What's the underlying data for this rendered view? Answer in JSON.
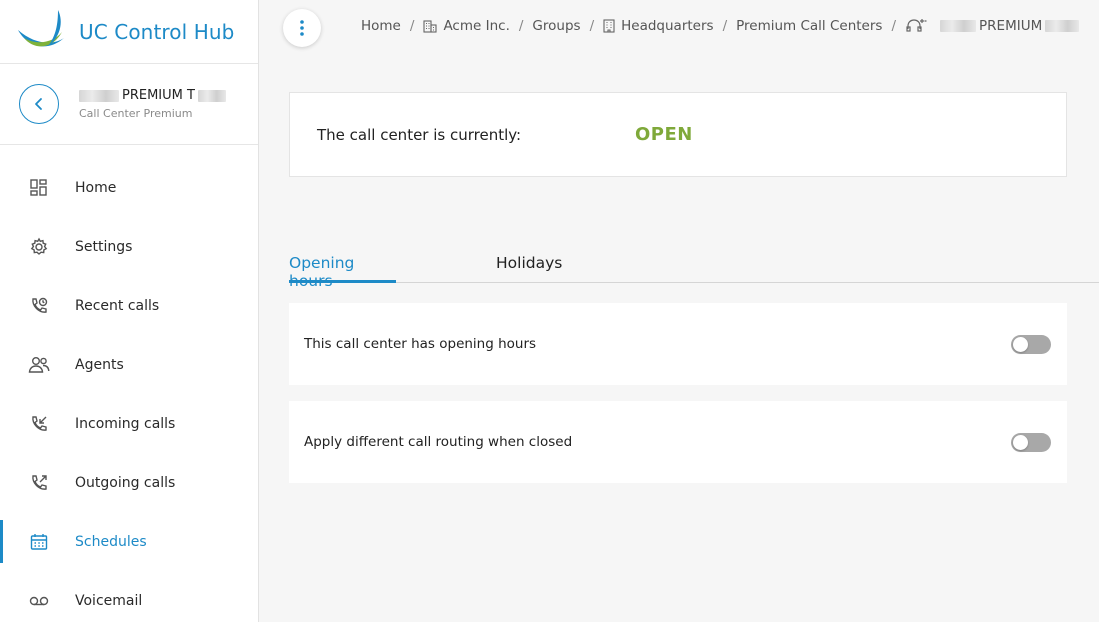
{
  "app": {
    "title": "UC Control Hub"
  },
  "entity": {
    "name_visible": "PREMIUM T",
    "subtitle": "Call Center Premium"
  },
  "sidebar": {
    "items": [
      {
        "label": "Home",
        "icon": "dashboard-icon"
      },
      {
        "label": "Settings",
        "icon": "gear-icon"
      },
      {
        "label": "Recent calls",
        "icon": "recent-calls-icon"
      },
      {
        "label": "Agents",
        "icon": "agents-icon"
      },
      {
        "label": "Incoming calls",
        "icon": "incoming-call-icon"
      },
      {
        "label": "Outgoing calls",
        "icon": "outgoing-call-icon"
      },
      {
        "label": "Schedules",
        "icon": "calendar-icon",
        "active": true
      },
      {
        "label": "Voicemail",
        "icon": "voicemail-icon"
      }
    ]
  },
  "breadcrumb": {
    "items": [
      "Home",
      "Acme Inc.",
      "Groups",
      "Headquarters",
      "Premium Call Centers"
    ],
    "current": "PREMIUM",
    "separator": "/"
  },
  "status": {
    "label": "The call center is currently:",
    "value": "OPEN"
  },
  "tabs": [
    "Opening hours",
    "Holidays"
  ],
  "options": [
    {
      "label": "This call center has opening hours",
      "enabled": false
    },
    {
      "label": "Apply different call routing when closed",
      "enabled": false
    }
  ],
  "colors": {
    "accent": "#1d8ac7",
    "open_status": "#7fa93a",
    "toggle_off": "#a8a8a8"
  }
}
